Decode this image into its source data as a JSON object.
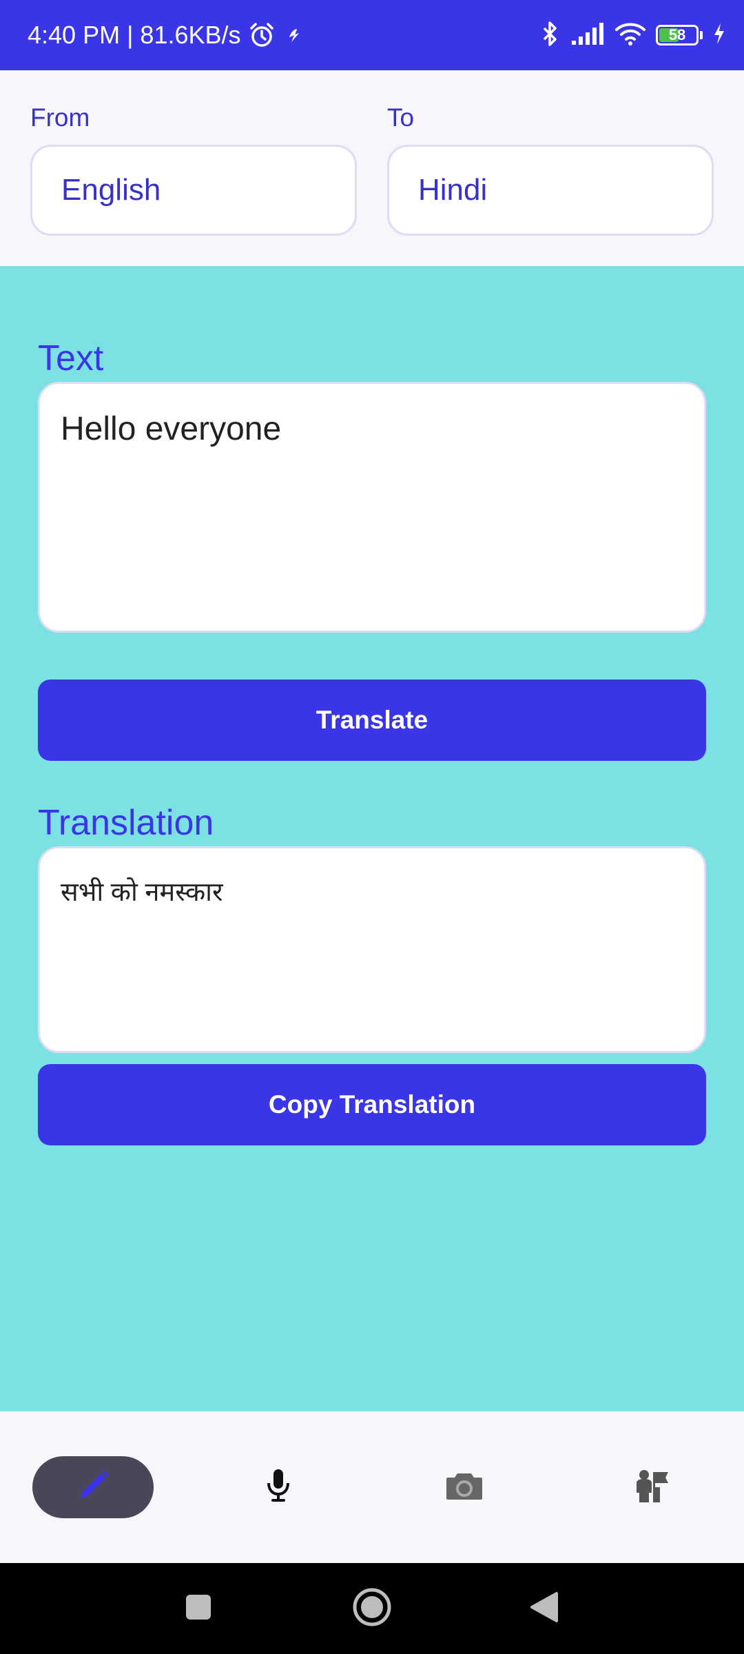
{
  "status_bar": {
    "time_speed": "4:40 PM | 81.6KB/s",
    "battery_level": "58",
    "battery_fraction": 0.58,
    "icons": [
      "alarm-icon",
      "flash-icon",
      "bluetooth-icon",
      "signal-icon",
      "wifi-icon",
      "battery-icon",
      "charging-icon"
    ]
  },
  "languages": {
    "from_label": "From",
    "from_value": "English",
    "to_label": "To",
    "to_value": "Hindi"
  },
  "input": {
    "label": "Text",
    "value": "Hello everyone"
  },
  "translate_button": "Translate",
  "output": {
    "label": "Translation",
    "value": "सभी को नमस्कार"
  },
  "copy_button": "Copy Translation",
  "bottom_nav": {
    "items": [
      {
        "name": "text",
        "icon": "pencil-icon",
        "active": true
      },
      {
        "name": "voice",
        "icon": "microphone-icon",
        "active": false
      },
      {
        "name": "camera",
        "icon": "camera-icon",
        "active": false
      },
      {
        "name": "conversation",
        "icon": "people-icon",
        "active": false
      }
    ]
  },
  "colors": {
    "primary": "#3a35e6",
    "main_background": "#7be1e3",
    "surface": "#f7f6fb",
    "active_nav": "#4a4657"
  }
}
